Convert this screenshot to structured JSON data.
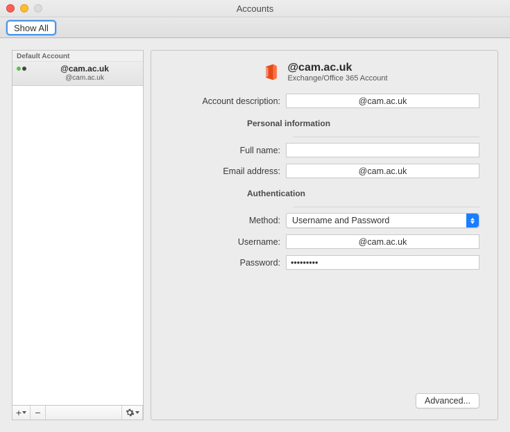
{
  "window": {
    "title": "Accounts",
    "show_all": "Show All"
  },
  "sidebar": {
    "default_label": "Default Account",
    "accounts": [
      {
        "name": "@cam.ac.uk",
        "sub": "@cam.ac.uk"
      }
    ],
    "footer": {
      "add": "+",
      "remove": "−"
    }
  },
  "main": {
    "header_title": "@cam.ac.uk",
    "header_sub": "Exchange/Office 365 Account",
    "labels": {
      "description": "Account description:",
      "personal": "Personal information",
      "full_name": "Full name:",
      "email": "Email address:",
      "authentication": "Authentication",
      "method": "Method:",
      "username": "Username:",
      "password": "Password:"
    },
    "values": {
      "description": "@cam.ac.uk",
      "full_name": "",
      "email": "@cam.ac.uk",
      "method": "Username and Password",
      "username": "@cam.ac.uk",
      "password": "•••••••••"
    },
    "advanced": "Advanced..."
  }
}
